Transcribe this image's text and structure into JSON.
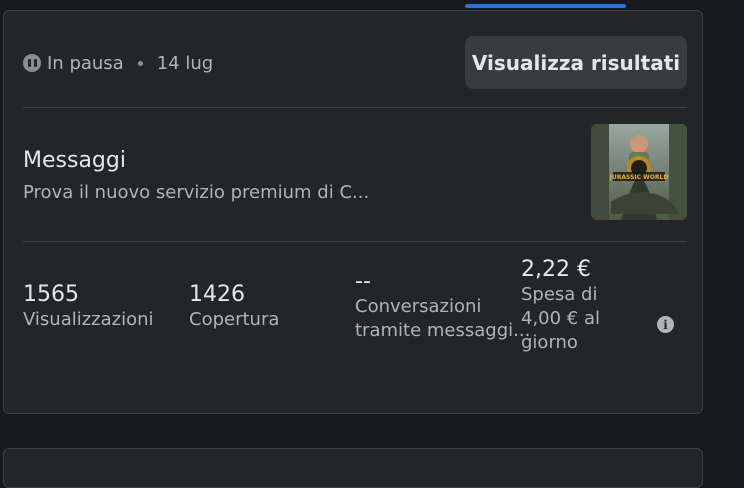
{
  "status": {
    "label": "In pausa",
    "date": "14 lug"
  },
  "actions": {
    "view_results": "Visualizza risultati"
  },
  "ad": {
    "title": "Messaggi",
    "description": "Prova il nuovo servizio premium di C...",
    "thumbnail_logo": "JURASSIC WORLD"
  },
  "metrics": [
    {
      "value": "1565",
      "label": "Visualizzazioni"
    },
    {
      "value": "1426",
      "label": "Copertura"
    },
    {
      "value": "--",
      "label_lines": [
        "Conversazioni",
        "tramite messaggi..."
      ]
    },
    {
      "value": "2,22 €",
      "label_lines": [
        "Spesa di",
        "4,00 € al",
        "giorno"
      ]
    }
  ],
  "colors": {
    "accent": "#2374e1",
    "card_bg": "#242526",
    "page_bg": "#18191a"
  },
  "icons": {
    "status": "pause-circle-icon",
    "info": "info-icon"
  }
}
